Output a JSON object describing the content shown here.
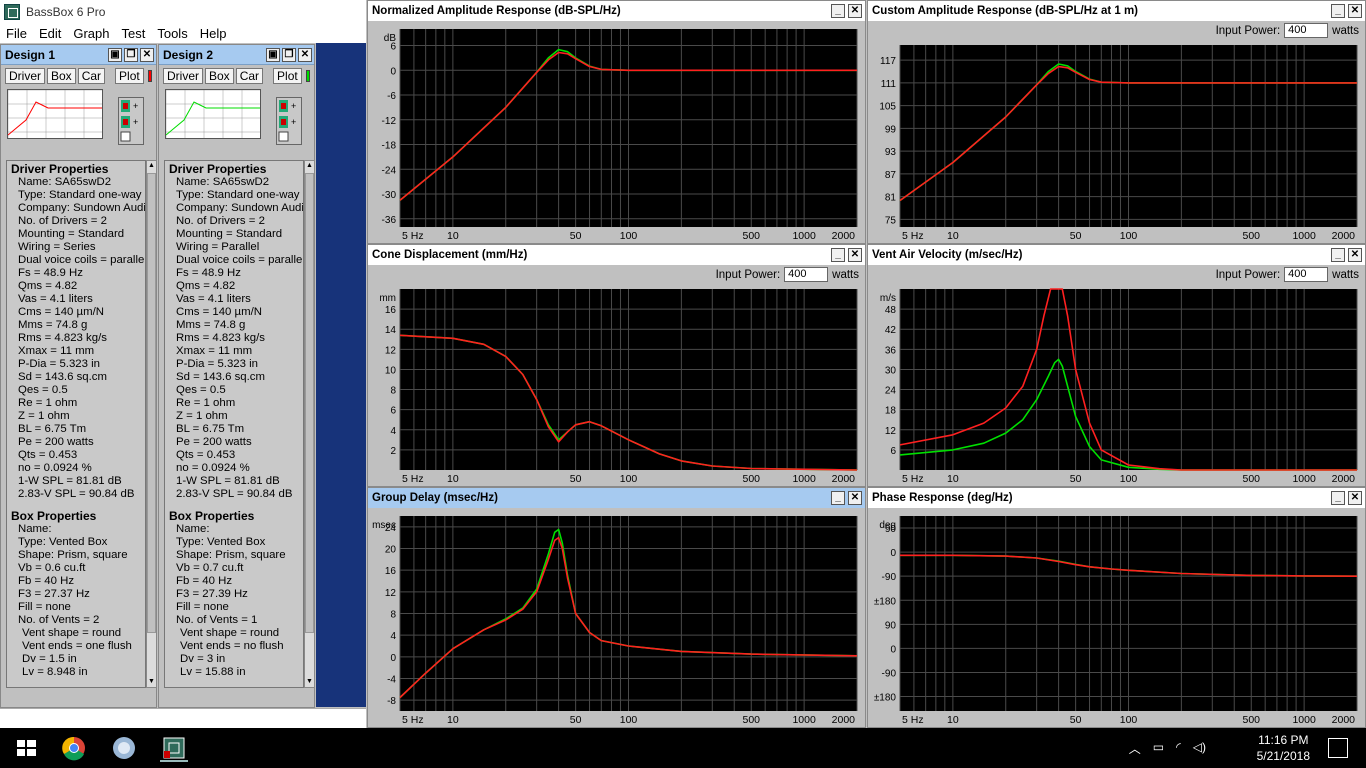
{
  "app": {
    "title": "BassBox 6 Pro",
    "menu": [
      "File",
      "Edit",
      "Graph",
      "Test",
      "Tools",
      "Help"
    ]
  },
  "designs": [
    {
      "title": "Design 1",
      "tabs": [
        "Driver",
        "Box",
        "Car"
      ],
      "plot_label": "Plot",
      "plot_color": "#ff0000",
      "driver_header": "Driver Properties",
      "driver": [
        "Name: SA65swD2",
        "Type: Standard one-way (",
        "Company: Sundown Audio",
        "No. of Drivers = 2",
        "Mounting = Standard",
        "Wiring = Series",
        "Dual voice coils = parallel",
        "Fs = 48.9 Hz",
        "Qms = 4.82",
        "Vas = 4.1 liters",
        "Cms = 140 µm/N",
        "Mms = 74.8 g",
        "Rms = 4.823 kg/s",
        "Xmax = 11 mm",
        "P-Dia = 5.323 in",
        "Sd = 143.6 sq.cm",
        "Qes = 0.5",
        "Re = 1 ohm",
        "Z = 1 ohm",
        "BL = 6.75 Tm",
        "Pe = 200 watts",
        "Qts = 0.453",
        "no = 0.0924 %",
        "1-W SPL = 81.81 dB",
        "2.83-V SPL = 90.84 dB"
      ],
      "box_header": "Box Properties",
      "box": [
        "Name:",
        "Type: Vented Box",
        "Shape: Prism, square",
        "Vb = 0.6 cu.ft",
        "Fb = 40 Hz",
        "F3 = 27.37 Hz",
        "Fill = none",
        "No. of Vents = 2"
      ],
      "vent": [
        "Vent shape = round",
        "Vent ends = one flush",
        "Dv = 1.5 in",
        "Lv = 8.948 in"
      ]
    },
    {
      "title": "Design 2",
      "tabs": [
        "Driver",
        "Box",
        "Car"
      ],
      "plot_label": "Plot",
      "plot_color": "#00dd00",
      "driver_header": "Driver Properties",
      "driver": [
        "Name: SA65swD2",
        "Type: Standard one-way (",
        "Company: Sundown Audio",
        "No. of Drivers = 2",
        "Mounting = Standard",
        "Wiring = Parallel",
        "Dual voice coils = parallel",
        "Fs = 48.9 Hz",
        "Qms = 4.82",
        "Vas = 4.1 liters",
        "Cms = 140 µm/N",
        "Mms = 74.8 g",
        "Rms = 4.823 kg/s",
        "Xmax = 11 mm",
        "P-Dia = 5.323 in",
        "Sd = 143.6 sq.cm",
        "Qes = 0.5",
        "Re = 1 ohm",
        "Z = 1 ohm",
        "BL = 6.75 Tm",
        "Pe = 200 watts",
        "Qts = 0.453",
        "no = 0.0924 %",
        "1-W SPL = 81.81 dB",
        "2.83-V SPL = 90.84 dB"
      ],
      "box_header": "Box Properties",
      "box": [
        "Name:",
        "Type: Vented Box",
        "Shape: Prism, square",
        "Vb = 0.7 cu.ft",
        "Fb = 40 Hz",
        "F3 = 27.39 Hz",
        "Fill = none",
        "No. of Vents = 1"
      ],
      "vent": [
        "Vent shape = round",
        "Vent ends = no flush",
        "Dv = 3 in",
        "Lv = 15.88 in"
      ]
    }
  ],
  "input_power_label": "Input Power:",
  "input_power_value": "400",
  "watts_label": "watts",
  "chart_data": [
    {
      "id": "norm",
      "type": "line",
      "title": "Normalized Amplitude Response (dB-SPL/Hz)",
      "ylabel": "dB",
      "x_scale": "log",
      "xlim": [
        5,
        2000
      ],
      "ylim": [
        -38,
        10
      ],
      "yticks": [
        "6",
        "0",
        "-6",
        "-12",
        "-18",
        "-24",
        "-30",
        "-36"
      ],
      "ytick_values": [
        6,
        0,
        -6,
        -12,
        -18,
        -24,
        -30,
        -36
      ],
      "xticks": [
        "5 Hz",
        "10",
        "50",
        "100",
        "500",
        "1000",
        "2000"
      ],
      "xtick_values": [
        5,
        10,
        50,
        100,
        500,
        1000,
        2000
      ],
      "series": [
        {
          "color": "#00e000",
          "x": [
            5,
            10,
            20,
            30,
            35,
            40,
            45,
            50,
            60,
            70,
            100,
            500,
            2000
          ],
          "y": [
            -31.5,
            -21,
            -9,
            -0.5,
            3,
            5,
            4.5,
            3,
            1,
            0.2,
            0,
            0,
            0
          ]
        },
        {
          "color": "#ff2020",
          "x": [
            5,
            10,
            20,
            30,
            35,
            40,
            45,
            50,
            60,
            70,
            100,
            500,
            2000
          ],
          "y": [
            -31.5,
            -21,
            -9,
            -0.5,
            2.5,
            4.3,
            4,
            2.8,
            0.9,
            0.2,
            0,
            0,
            0
          ]
        }
      ]
    },
    {
      "id": "custom",
      "type": "line",
      "title": "Custom Amplitude Response (dB-SPL/Hz at 1 m)",
      "ylabel": "",
      "x_scale": "log",
      "xlim": [
        5,
        2000
      ],
      "ylim": [
        73,
        121
      ],
      "power": true,
      "yticks": [
        "117",
        "111",
        "105",
        "99",
        "93",
        "87",
        "81",
        "75"
      ],
      "ytick_values": [
        117,
        111,
        105,
        99,
        93,
        87,
        81,
        75
      ],
      "xticks": [
        "5 Hz",
        "10",
        "50",
        "100",
        "500",
        "1000",
        "2000"
      ],
      "xtick_values": [
        5,
        10,
        50,
        100,
        500,
        1000,
        2000
      ],
      "series": [
        {
          "color": "#00e000",
          "x": [
            5,
            10,
            20,
            30,
            35,
            40,
            45,
            50,
            60,
            70,
            100,
            500,
            2000
          ],
          "y": [
            80,
            90,
            102,
            110.5,
            114,
            116,
            115.5,
            114,
            112,
            111.2,
            111,
            111,
            111
          ]
        },
        {
          "color": "#ff2020",
          "x": [
            5,
            10,
            20,
            30,
            35,
            40,
            45,
            50,
            60,
            70,
            100,
            500,
            2000
          ],
          "y": [
            80,
            90,
            102,
            110.5,
            113.5,
            115.3,
            115,
            113.8,
            111.9,
            111.2,
            111,
            111,
            111
          ]
        }
      ]
    },
    {
      "id": "cone",
      "type": "line",
      "title": "Cone Displacement (mm/Hz)",
      "ylabel": "mm",
      "x_scale": "log",
      "xlim": [
        5,
        2000
      ],
      "ylim": [
        0,
        18
      ],
      "power": true,
      "yticks": [
        "16",
        "14",
        "12",
        "10",
        "8",
        "6",
        "4",
        "2"
      ],
      "ytick_values": [
        16,
        14,
        12,
        10,
        8,
        6,
        4,
        2
      ],
      "xticks": [
        "5 Hz",
        "10",
        "50",
        "100",
        "500",
        "1000",
        "2000"
      ],
      "xtick_values": [
        5,
        10,
        50,
        100,
        500,
        1000,
        2000
      ],
      "series": [
        {
          "color": "#00e000",
          "x": [
            5,
            10,
            15,
            20,
            25,
            30,
            35,
            40,
            45,
            50,
            60,
            70,
            100,
            150,
            200,
            300,
            500,
            2000
          ],
          "y": [
            13.4,
            13.1,
            12.5,
            11.3,
            9.5,
            7,
            4.5,
            3,
            3.8,
            4.5,
            4.8,
            4.4,
            3,
            1.6,
            0.9,
            0.4,
            0.15,
            0
          ]
        },
        {
          "color": "#ff2020",
          "x": [
            5,
            10,
            15,
            20,
            25,
            30,
            35,
            40,
            45,
            50,
            60,
            70,
            100,
            150,
            200,
            300,
            500,
            2000
          ],
          "y": [
            13.4,
            13.1,
            12.5,
            11.3,
            9.5,
            7,
            4.3,
            2.8,
            3.8,
            4.5,
            4.8,
            4.4,
            3,
            1.6,
            0.9,
            0.4,
            0.15,
            0
          ]
        }
      ]
    },
    {
      "id": "vent",
      "type": "line",
      "title": "Vent Air Velocity (m/sec/Hz)",
      "ylabel": "m/s",
      "x_scale": "log",
      "xlim": [
        5,
        2000
      ],
      "ylim": [
        0,
        54
      ],
      "power": true,
      "yticks": [
        "48",
        "42",
        "36",
        "30",
        "24",
        "18",
        "12",
        "6"
      ],
      "ytick_values": [
        48,
        42,
        36,
        30,
        24,
        18,
        12,
        6
      ],
      "xticks": [
        "5 Hz",
        "10",
        "50",
        "100",
        "500",
        "1000",
        "2000"
      ],
      "xtick_values": [
        5,
        10,
        50,
        100,
        500,
        1000,
        2000
      ],
      "series": [
        {
          "color": "#00e000",
          "x": [
            5,
            10,
            15,
            20,
            25,
            30,
            35,
            38,
            40,
            42,
            45,
            50,
            60,
            70,
            100,
            150,
            200,
            2000
          ],
          "y": [
            4.5,
            6,
            8,
            11,
            15,
            21,
            28,
            32,
            33,
            31,
            25,
            16,
            7,
            3,
            0.8,
            0.2,
            0,
            0
          ]
        },
        {
          "color": "#ff2020",
          "x": [
            5,
            10,
            15,
            20,
            25,
            30,
            33,
            36,
            38,
            40,
            42,
            45,
            50,
            60,
            70,
            100,
            150,
            200,
            2000
          ],
          "y": [
            7.5,
            10.5,
            14,
            18.5,
            25,
            36,
            46,
            54,
            58,
            58,
            54,
            46,
            30,
            14,
            6,
            1.5,
            0.4,
            0,
            0
          ]
        }
      ]
    },
    {
      "id": "group",
      "type": "line",
      "title": "Group Delay (msec/Hz)",
      "ylabel": "msec",
      "x_scale": "log",
      "xlim": [
        5,
        2000
      ],
      "ylim": [
        -10,
        26
      ],
      "yticks": [
        "24",
        "20",
        "16",
        "12",
        "8",
        "4",
        "0",
        "-4",
        "-8"
      ],
      "ytick_values": [
        24,
        20,
        16,
        12,
        8,
        4,
        0,
        -4,
        -8
      ],
      "xticks": [
        "5 Hz",
        "10",
        "50",
        "100",
        "500",
        "1000",
        "2000"
      ],
      "xtick_values": [
        5,
        10,
        50,
        100,
        500,
        1000,
        2000
      ],
      "series": [
        {
          "color": "#00e000",
          "x": [
            5,
            7,
            10,
            15,
            20,
            25,
            30,
            35,
            38,
            40,
            42,
            45,
            50,
            60,
            70,
            100,
            200,
            500,
            2000
          ],
          "y": [
            -7.5,
            -3,
            1.5,
            5,
            7,
            9,
            12.5,
            19,
            23,
            23.5,
            21,
            15,
            8,
            4.5,
            3,
            2,
            1,
            0.5,
            0.2
          ]
        },
        {
          "color": "#ff2020",
          "x": [
            5,
            7,
            10,
            15,
            20,
            25,
            30,
            35,
            38,
            40,
            42,
            45,
            50,
            60,
            70,
            100,
            200,
            500,
            2000
          ],
          "y": [
            -7.5,
            -3,
            1.5,
            5,
            6.8,
            8.8,
            12,
            18,
            21.5,
            22,
            20,
            14.5,
            8,
            4.5,
            3,
            2,
            1,
            0.5,
            0.2
          ]
        }
      ]
    },
    {
      "id": "phase",
      "type": "line",
      "title": "Phase Response (deg/Hz)",
      "ylabel": "deg",
      "x_scale": "log",
      "xlim": [
        5,
        2000
      ],
      "ylim": [
        -200,
        125
      ],
      "yticks": [
        "90",
        "0",
        "-90",
        "±180",
        "90",
        "0",
        "-90",
        "±180"
      ],
      "ytick_values": [
        90,
        0,
        -90,
        -180,
        90,
        0,
        -90,
        -180
      ],
      "xticks": [
        "5 Hz",
        "10",
        "50",
        "100",
        "500",
        "1000",
        "2000"
      ],
      "xtick_values": [
        5,
        10,
        50,
        100,
        500,
        1000,
        2000
      ],
      "series": [
        {
          "color": "#00e000",
          "x": [
            5,
            10,
            20,
            30,
            40,
            50,
            60,
            80,
            100,
            200,
            500,
            1000,
            2000
          ],
          "y": [
            -12,
            -12,
            -15,
            -22,
            -34,
            -46,
            -55,
            -63,
            -68,
            -80,
            -87,
            -89,
            -90
          ]
        },
        {
          "color": "#ff2020",
          "x": [
            5,
            10,
            20,
            30,
            40,
            50,
            60,
            80,
            100,
            200,
            500,
            1000,
            2000
          ],
          "y": [
            -12,
            -12,
            -15,
            -22,
            -35,
            -47,
            -55,
            -63,
            -68,
            -80,
            -87,
            -89,
            -90
          ]
        }
      ]
    }
  ],
  "clock": {
    "time": "11:16 PM",
    "date": "5/21/2018"
  }
}
